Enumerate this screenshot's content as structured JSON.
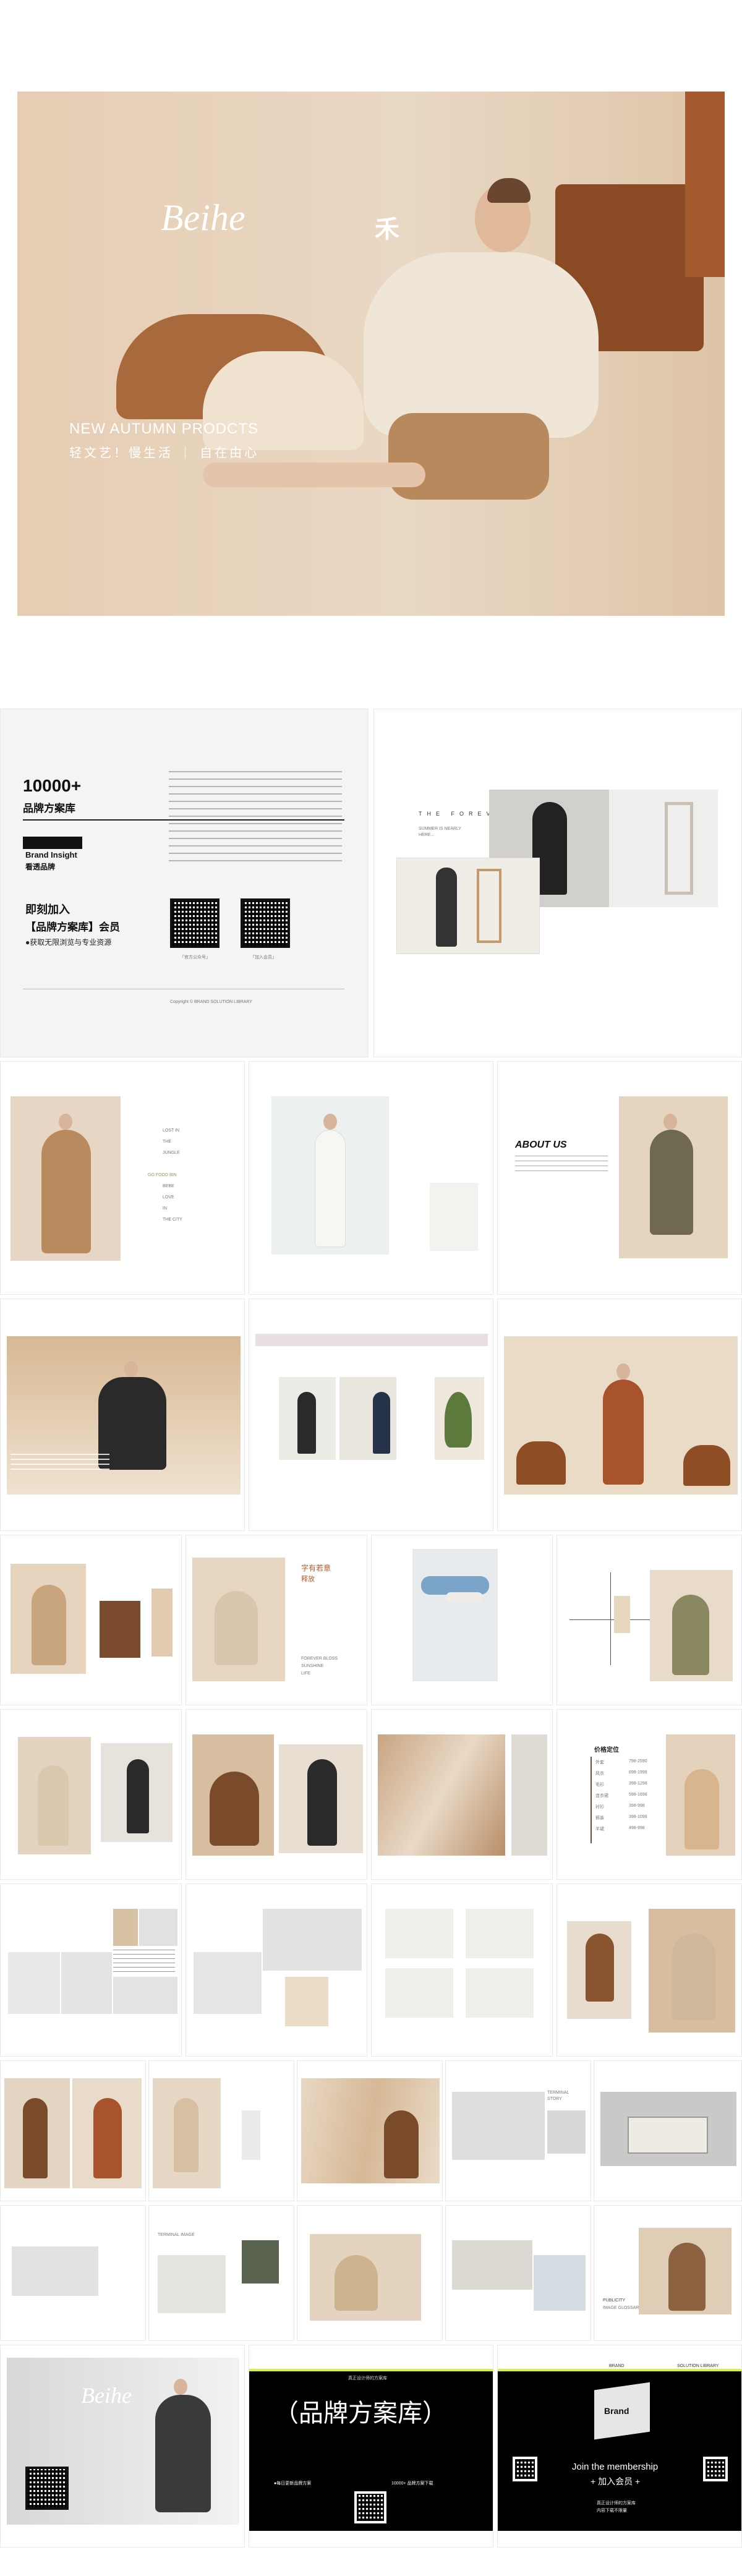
{
  "cover": {
    "logo": "Beihe",
    "logo_mark": "禾",
    "headline": "NEW AUTUMN PRODCTS",
    "subline": "轻文艺！慢生活 ｜ 自在由心"
  },
  "intro": {
    "count": "10000+",
    "library": "品牌方案库",
    "brand_line1": "Brand Insight",
    "brand_line2": "看透品牌",
    "join": "即刻加入",
    "join_member": "【品牌方案库】会员",
    "join_sub": "●获取无限浏览与专业资源",
    "qr1_label": "「官方公众号」",
    "qr2_label": "「加入会员」",
    "copyright": "Copyright © BRAND SOLUTION LIBRARY"
  },
  "spread_forever": {
    "title": "THE FOREVER",
    "sub1": "SUMMER IS NEARLY",
    "sub2": "HERE..."
  },
  "lost_words": [
    "LOST IN",
    "THE",
    "JUNGLE",
    "GO FOOD BIN",
    "BEBE",
    "LOVE",
    "IN",
    "THE CITY"
  ],
  "about": {
    "title": "ABOUT US"
  },
  "poem": {
    "title": "字有若意",
    "sub": "释放",
    "lines": [
      "FOREVER BLOSS",
      "SUNSHINE",
      "LIFE"
    ]
  },
  "price_table": {
    "title": "价格定位",
    "items": [
      "外套",
      "风衣",
      "毛衫",
      "连衣裙",
      "衬衫",
      "裤装",
      "半裙"
    ],
    "prices": [
      "798-2590",
      "698-1998",
      "398-1298",
      "598-1698",
      "398-998",
      "398-1098",
      "498-998"
    ]
  },
  "store": {
    "label1": "TERMINAL",
    "label2": "STORY",
    "label3": "TERMINAL IMAGE",
    "label4": "PUBLICITY",
    "label5": "IMAGE GLOSSARY"
  },
  "ending": {
    "logo": "Beihe",
    "top_label": "真正设计师的方案库",
    "big_title": "（品牌方案库）",
    "bullet": "●每日更新品牌方案",
    "count_line": "10000+ 品牌方案下载",
    "join_en": "Join the membership",
    "join_cn": "+ 加入会员 +",
    "join_foot": "真正设计师的方案库",
    "join_foot2": "内容下载不限量",
    "brand_badge": "Brand",
    "brand_small": "BRAND",
    "solution": "SOLUTION LIBRARY"
  }
}
